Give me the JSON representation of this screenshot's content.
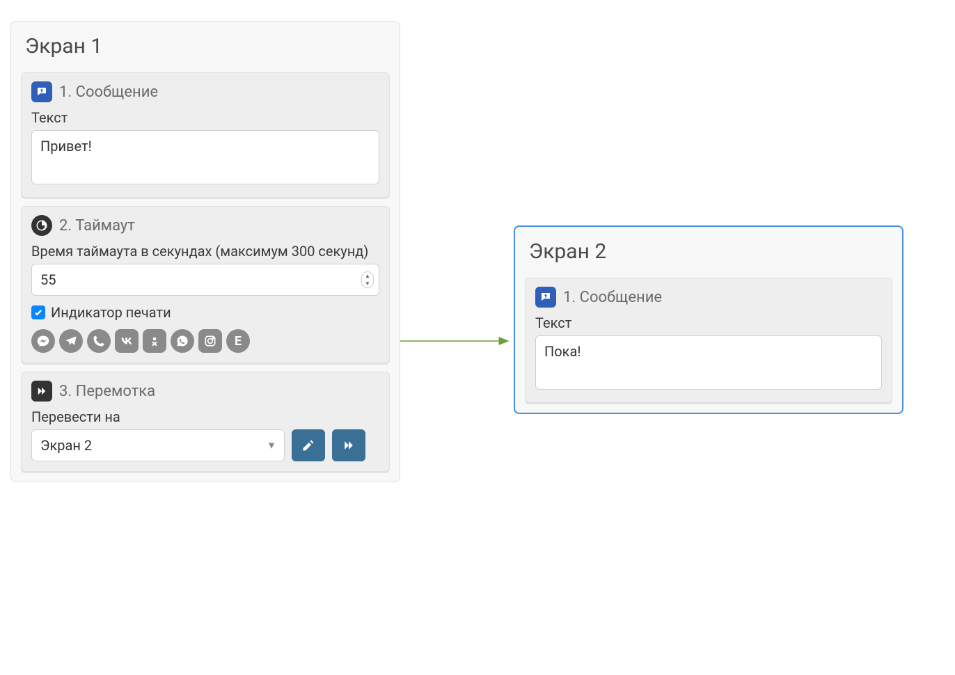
{
  "screen1": {
    "title": "Экран 1",
    "block1": {
      "icon": "message-send-icon",
      "title": "1. Сообщение",
      "text_label": "Текст",
      "text_value": "Привет!"
    },
    "block2": {
      "icon": "clock-icon",
      "title": "2. Таймаут",
      "timeout_label": "Время таймаута в секундах (максимум 300 секунд)",
      "timeout_value": "55",
      "typing_indicator_label": "Индикатор печати",
      "typing_indicator_checked": true,
      "social_icons": [
        "messenger",
        "telegram",
        "viber",
        "vk",
        "ok",
        "whatsapp",
        "instagram",
        "e-chat"
      ]
    },
    "block3": {
      "icon": "fast-forward-icon",
      "title": "3. Перемотка",
      "redirect_label": "Перевести на",
      "redirect_value": "Экран 2"
    }
  },
  "screen2": {
    "title": "Экран 2",
    "selected": true,
    "block1": {
      "icon": "message-send-icon",
      "title": "1. Сообщение",
      "text_label": "Текст",
      "text_value": "Пока!"
    }
  },
  "connection": {
    "from": "screen1",
    "to": "screen2"
  }
}
